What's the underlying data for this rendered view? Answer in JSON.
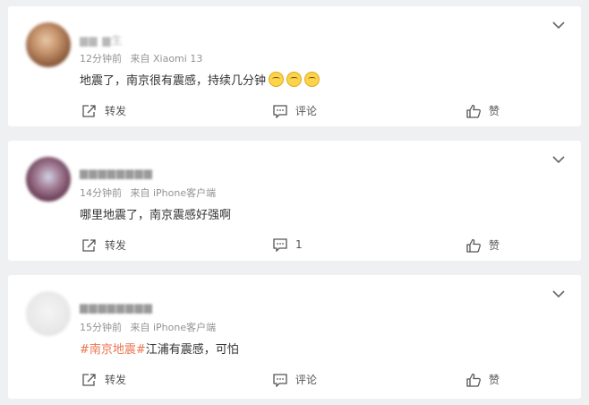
{
  "comments": [
    {
      "username": "▆▆ ▆生",
      "time": "12分钟前",
      "source": "来自 Xiaomi 13",
      "text_tag": "",
      "text": "地震了，南京很有震感，持续几分钟",
      "emoji_count": 3,
      "actions": {
        "share": "转发",
        "comment": "评论",
        "like": "赞"
      }
    },
    {
      "username": "▆▆▆▆▆▆▆▆",
      "time": "14分钟前",
      "source": "来自 iPhone客户端",
      "text_tag": "",
      "text": "哪里地震了，南京震感好强啊",
      "emoji_count": 0,
      "actions": {
        "share": "转发",
        "comment": "1",
        "like": "赞"
      }
    },
    {
      "username": "▆▆▆▆▆▆▆▆",
      "time": "15分钟前",
      "source": "来自 iPhone客户端",
      "text_tag": "#南京地震#",
      "text": "江浦有震感，可怕",
      "emoji_count": 0,
      "actions": {
        "share": "转发",
        "comment": "评论",
        "like": "赞"
      }
    }
  ],
  "colors": {
    "background": "#eef0f2",
    "card": "#ffffff",
    "text": "#333333",
    "meta": "#939393",
    "topic": "#eb7350"
  },
  "icons": [
    "chevron-down-icon",
    "share-icon",
    "comment-icon",
    "like-icon",
    "smile-emoji-icon"
  ]
}
